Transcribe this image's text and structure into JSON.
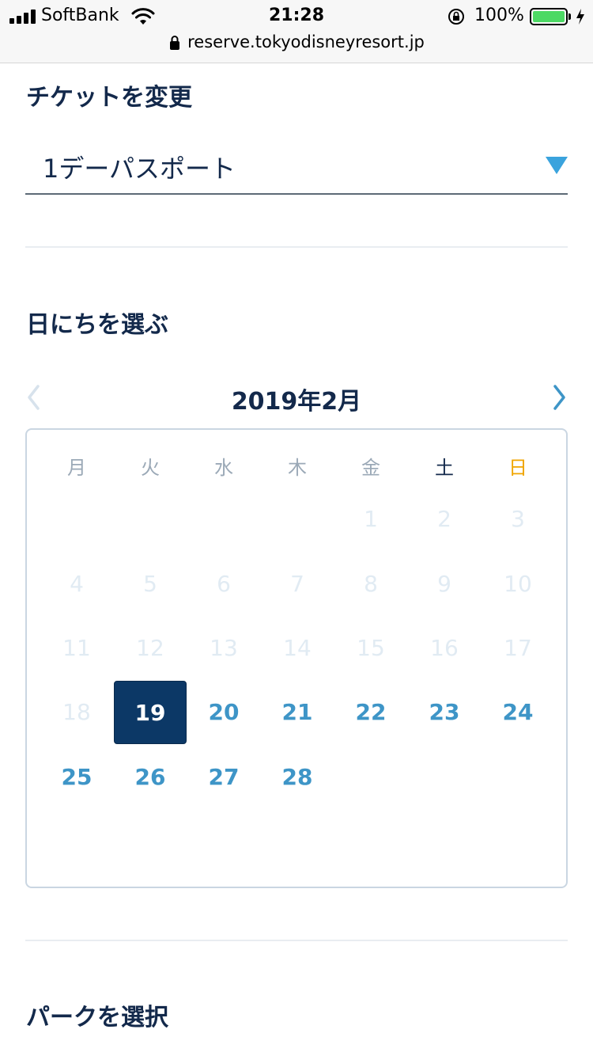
{
  "status_bar": {
    "carrier": "SoftBank",
    "time": "21:28",
    "battery_percent": "100%",
    "url": "reserve.tokyodisneyresort.jp"
  },
  "ticket_section": {
    "title": "チケットを変更",
    "selected_ticket": "1デーパスポート"
  },
  "date_section": {
    "title": "日にちを選ぶ",
    "month_label": "2019年2月",
    "weekdays": [
      "月",
      "火",
      "水",
      "木",
      "金",
      "土",
      "日"
    ],
    "weeks": [
      [
        {
          "d": "",
          "s": "empty"
        },
        {
          "d": "",
          "s": "empty"
        },
        {
          "d": "",
          "s": "empty"
        },
        {
          "d": "",
          "s": "empty"
        },
        {
          "d": "1",
          "s": "disabled"
        },
        {
          "d": "2",
          "s": "disabled"
        },
        {
          "d": "3",
          "s": "disabled"
        }
      ],
      [
        {
          "d": "4",
          "s": "disabled"
        },
        {
          "d": "5",
          "s": "disabled"
        },
        {
          "d": "6",
          "s": "disabled"
        },
        {
          "d": "7",
          "s": "disabled"
        },
        {
          "d": "8",
          "s": "disabled"
        },
        {
          "d": "9",
          "s": "disabled"
        },
        {
          "d": "10",
          "s": "disabled"
        }
      ],
      [
        {
          "d": "11",
          "s": "disabled"
        },
        {
          "d": "12",
          "s": "disabled"
        },
        {
          "d": "13",
          "s": "disabled"
        },
        {
          "d": "14",
          "s": "disabled"
        },
        {
          "d": "15",
          "s": "disabled"
        },
        {
          "d": "16",
          "s": "disabled"
        },
        {
          "d": "17",
          "s": "disabled"
        }
      ],
      [
        {
          "d": "18",
          "s": "disabled"
        },
        {
          "d": "19",
          "s": "selected"
        },
        {
          "d": "20",
          "s": "available"
        },
        {
          "d": "21",
          "s": "available"
        },
        {
          "d": "22",
          "s": "available"
        },
        {
          "d": "23",
          "s": "available"
        },
        {
          "d": "24",
          "s": "available"
        }
      ],
      [
        {
          "d": "25",
          "s": "available"
        },
        {
          "d": "26",
          "s": "available"
        },
        {
          "d": "27",
          "s": "available"
        },
        {
          "d": "28",
          "s": "available"
        },
        {
          "d": "",
          "s": "empty"
        },
        {
          "d": "",
          "s": "empty"
        },
        {
          "d": "",
          "s": "empty"
        }
      ]
    ]
  },
  "park_section": {
    "title": "パークを選択"
  },
  "colors": {
    "navy": "#13294b",
    "selected_bg": "#0c3866",
    "available": "#3e95c7",
    "disabled": "#e1ebf3",
    "sunday": "#f0a500",
    "dropdown_arrow": "#3aa3dd"
  }
}
